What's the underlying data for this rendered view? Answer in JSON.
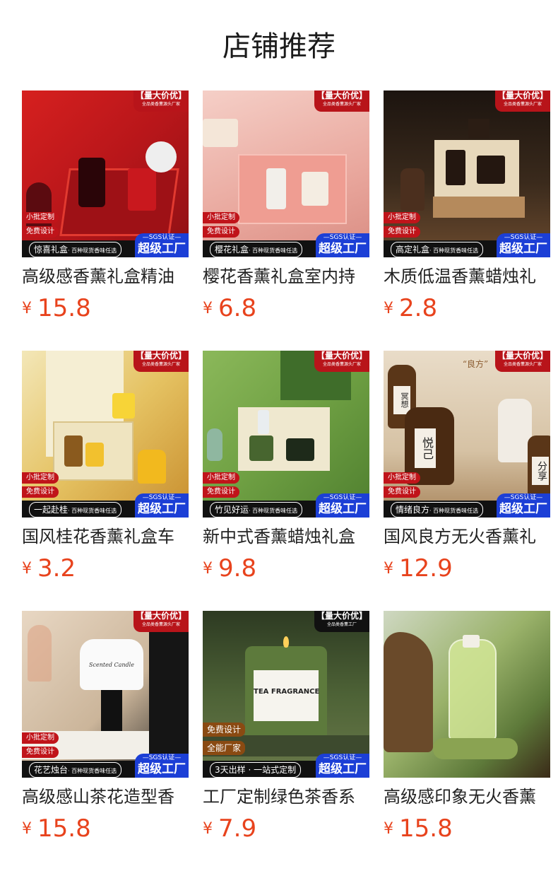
{
  "title": "店铺推荐",
  "badges": {
    "top_main": "【量大价优】",
    "top_sub": "全品类香薰源头厂家",
    "top_sub_alt": "全品类香薰工厂",
    "small_batch": "小批定制",
    "free_design": "免费设计",
    "full_factory": "全能厂家",
    "sgs": "—SGS认证—",
    "super_factory": "超级工厂",
    "bar_sub": "· 百种现货香味任选",
    "bar_sub_alt": "· 一站式定制"
  },
  "products": [
    {
      "name": "高级感香薰礼盒精油",
      "currency": "¥",
      "price": "15.8",
      "bar_main": "惊喜礼盒"
    },
    {
      "name": "樱花香薰礼盒室内持",
      "currency": "¥",
      "price": "6.8",
      "bar_main": "樱花礼盒"
    },
    {
      "name": "木质低温香薰蜡烛礼",
      "currency": "¥",
      "price": "2.8",
      "bar_main": "高定礼盒"
    },
    {
      "name": "国风桂花香薰礼盒车",
      "currency": "¥",
      "price": "3.2",
      "bar_main": "一起赴桂"
    },
    {
      "name": "新中式香薰蜡烛礼盒",
      "currency": "¥",
      "price": "9.8",
      "bar_main": "竹见好运"
    },
    {
      "name": "国风良方无火香薰礼",
      "currency": "¥",
      "price": "12.9",
      "bar_main": "情绪良方"
    },
    {
      "name": "高级感山茶花造型香",
      "currency": "¥",
      "price": "15.8",
      "bar_main": "花艺烛台"
    },
    {
      "name": "工厂定制绿色茶香系",
      "currency": "¥",
      "price": "7.9",
      "bar_main": "3天出样"
    },
    {
      "name": "高级感印象无火香薰",
      "currency": "¥",
      "price": "15.8",
      "bar_main": ""
    }
  ],
  "image_text": {
    "tea_label": "TEA FRAGRANCE",
    "candle_label": "Scented Candle",
    "bottle1": "冥想",
    "bottle2": "悦己",
    "bottle3": "分享",
    "liangfang": "“良方”"
  },
  "colors": {
    "price": "#e8431d",
    "badge_red": "#b8141a",
    "factory_blue": "#1c3fd6"
  }
}
